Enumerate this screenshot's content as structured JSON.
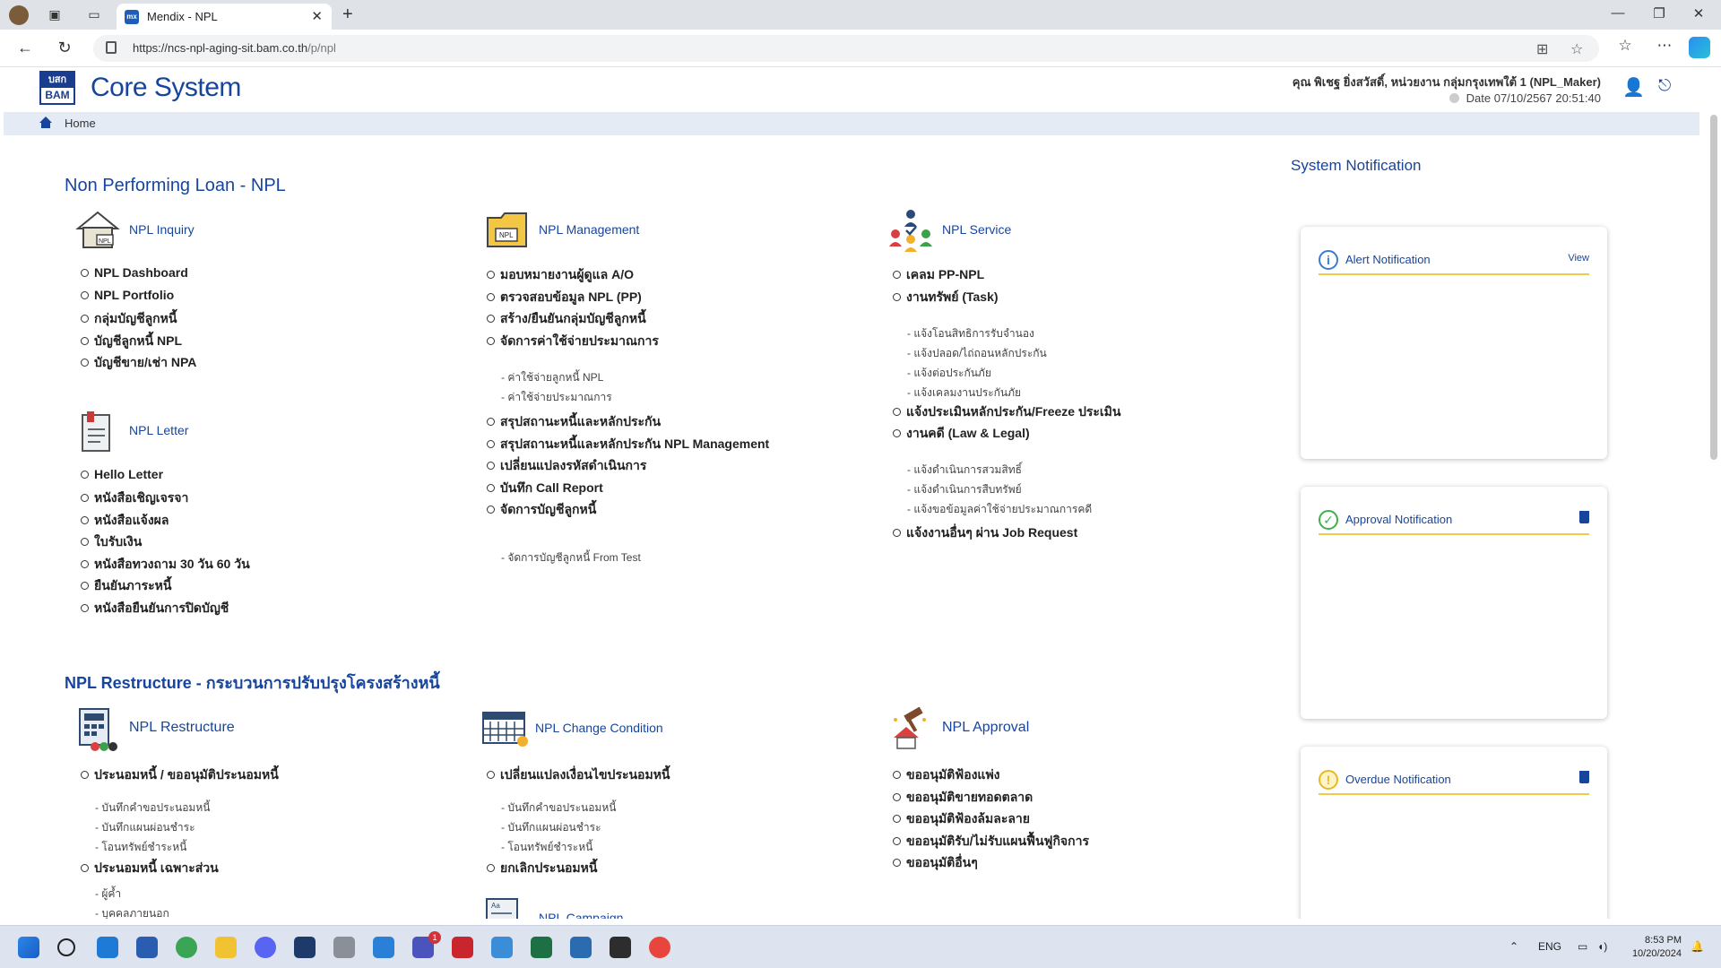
{
  "browser": {
    "tab_title": "Mendix - NPL",
    "tab_favicon": "mx",
    "url_host": "https://ncs-npl-aging-sit.bam.co.th",
    "url_path": "/p/npl"
  },
  "header": {
    "logo_top": "บสก",
    "logo_bottom": "BAM",
    "app_title": "Core System",
    "user_text": "คุณ พิเชฐ ยิ่งสวัสดิ์, หน่วยงาน กลุ่มกรุงเทพใต้ 1 (NPL_Maker)",
    "date_text": "Date 07/10/2567 20:51:40"
  },
  "breadcrumb": {
    "home": "Home"
  },
  "npl": {
    "title": "Non Performing Loan - NPL",
    "inquiry": {
      "label": "NPL Inquiry",
      "items": [
        "NPL Dashboard",
        "NPL Portfolio",
        "กลุ่มบัญชีลูกหนี้",
        "บัญชีลูกหนี้ NPL",
        "บัญชีขาย/เช่า NPA"
      ]
    },
    "letter": {
      "label": "NPL Letter",
      "items": [
        "Hello Letter",
        "หนังสือเชิญเจรจา",
        "หนังสือแจ้งผล",
        "ใบรับเงิน",
        "หนังสือทวงถาม 30 วัน 60 วัน",
        "ยืนยันภาระหนี้",
        "หนังสือยืนยันการปิดบัญชี"
      ]
    },
    "management": {
      "label": "NPL Management",
      "items": [
        "มอบหมายงานผู้ดูแล A/O",
        "ตรวจสอบข้อมูล NPL (PP)",
        "สร้าง/ยืนยันกลุ่มบัญชีลูกหนี้",
        "จัดการค่าใช้จ่ายประมาณการ"
      ],
      "subs1": [
        "- ค่าใช้จ่ายลูกหนี้ NPL",
        "- ค่าใช้จ่ายประมาณการ"
      ],
      "items2": [
        "สรุปสถานะหนี้และหลักประกัน",
        "สรุปสถานะหนี้และหลักประกัน NPL Management",
        "เปลี่ยนแปลงรหัสดำเนินการ",
        "บันทึก Call Report",
        "จัดการบัญชีลูกหนี้"
      ],
      "subs2": [
        "- จัดการบัญชีลูกหนี้ From Test"
      ]
    },
    "service": {
      "label": "NPL Service",
      "items": [
        "เคลม PP-NPL",
        "งานทรัพย์ (Task)"
      ],
      "subs1": [
        "- แจ้งโอนสิทธิการรับจำนอง",
        "- แจ้งปลอด/ไถ่ถอนหลักประกัน",
        "- แจ้งต่อประกันภัย",
        "- แจ้งเคลมงานประกันภัย"
      ],
      "items2": [
        "แจ้งประเมินหลักประกัน/Freeze ประเมิน",
        "งานคดี (Law & Legal)"
      ],
      "subs2": [
        "- แจ้งดำเนินการสวมสิทธิ์",
        "- แจ้งดำเนินการสืบทรัพย์",
        "- แจ้งขอข้อมูลค่าใช้จ่ายประมาณการคดี"
      ],
      "items3": [
        "แจ้งงานอื่นๆ ผ่าน Job Request"
      ]
    }
  },
  "restructure": {
    "title": "NPL Restructure - กระบวนการปรับปรุงโครงสร้างหนี้",
    "restructure_col": {
      "label": "NPL Restructure",
      "items": [
        "ประนอมหนี้ / ขออนุมัติประนอมหนี้"
      ],
      "subs1": [
        "- บันทึกคำขอประนอมหนี้",
        "- บันทึกแผนผ่อนชำระ",
        "- โอนทรัพย์ชำระหนี้"
      ],
      "items2": [
        "ประนอมหนี้ เฉพาะส่วน"
      ],
      "subs2": [
        "- ผู้ค้ำ",
        "- บุคคลภายนอก"
      ]
    },
    "change": {
      "label": "NPL Change Condition",
      "items": [
        "เปลี่ยนแปลงเงื่อนไขประนอมหนี้"
      ],
      "subs1": [
        "- บันทึกคำขอประนอมหนี้",
        "- บันทึกแผนผ่อนชำระ",
        "- โอนทรัพย์ชำระหนี้"
      ],
      "items2": [
        "ยกเลิกประนอมหนี้"
      ],
      "campaign": "NPL Campaign"
    },
    "approval": {
      "label": "NPL Approval",
      "items": [
        "ขออนุมัติฟ้องแพ่ง",
        "ขออนุมัติขายทอดตลาด",
        "ขออนุมัติฟ้องล้มละลาย",
        "ขออนุมัติรับ/ไม่รับแผนฟื้นฟูกิจการ",
        "ขออนุมัติอื่นๆ"
      ]
    }
  },
  "notifications": {
    "title": "System Notification",
    "alert": {
      "label": "Alert Notification",
      "action": "View"
    },
    "approval": {
      "label": "Approval Notification"
    },
    "overdue": {
      "label": "Overdue Notification"
    }
  },
  "taskbar": {
    "lang": "ENG",
    "time": "8:53 PM",
    "date": "10/20/2024",
    "teams_badge": "1"
  },
  "colors": {
    "brand": "#17459c",
    "accent": "#f1c94b",
    "breadcrumb_bg": "#e4ebf5"
  }
}
